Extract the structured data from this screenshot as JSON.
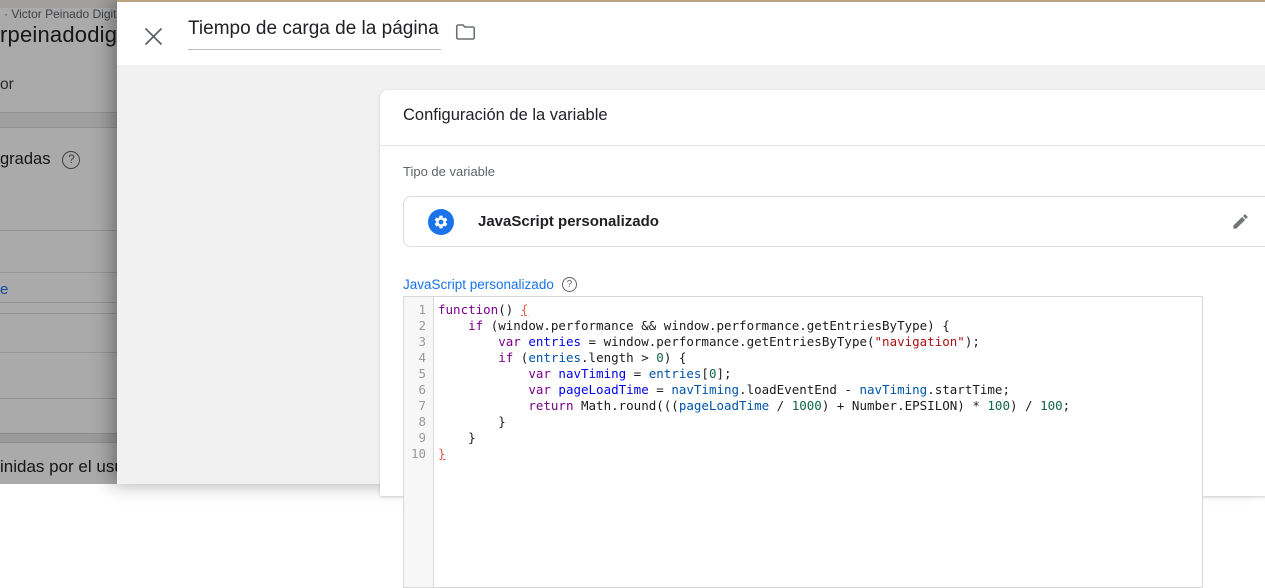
{
  "background_page": {
    "breadcrumb_fragment": "· Victor Peinado Digit",
    "container_name_fragment": "rpeinadodig",
    "menu_fragment": "or",
    "builtin_variables_heading_fragment": "gradas",
    "variable_link_fragment": "e",
    "user_defined_heading_fragment": "inidas por el usu"
  },
  "panel": {
    "title": "Tiempo de carga de la página",
    "card": {
      "title": "Configuración de la variable",
      "type_section_label": "Tipo de variable",
      "type_value": "JavaScript personalizado",
      "code_section_label": "JavaScript personalizado"
    }
  },
  "icons": {
    "help_glyph": "?"
  },
  "colors": {
    "accent_blue": "#1a73e8",
    "type_icon_bg": "#1a73e8",
    "panel_top_accent": "#b7a47e",
    "code_keyword": "#770088",
    "code_def": "#0000ee",
    "code_variable": "#0055aa",
    "code_string": "#aa1111",
    "code_number": "#116644",
    "code_bracket_highlight": "#e0594a"
  },
  "code_editor": {
    "line_count": 10,
    "lines": [
      [
        [
          "function",
          "kw"
        ],
        [
          "() ",
          "pl"
        ],
        [
          "{",
          "bm"
        ]
      ],
      [
        [
          "    ",
          "pl"
        ],
        [
          "if",
          "kw"
        ],
        [
          " (window.performance && window.performance.getEntriesByType) {",
          "pl"
        ]
      ],
      [
        [
          "        ",
          "pl"
        ],
        [
          "var",
          "kw"
        ],
        [
          " ",
          "pl"
        ],
        [
          "entries",
          "df"
        ],
        [
          " = window.performance.getEntriesByType(",
          "pl"
        ],
        [
          "\"navigation\"",
          "st"
        ],
        [
          ");",
          "pl"
        ]
      ],
      [
        [
          "        ",
          "pl"
        ],
        [
          "if",
          "kw"
        ],
        [
          " (",
          "pl"
        ],
        [
          "entries",
          "vr"
        ],
        [
          ".length > ",
          "pl"
        ],
        [
          "0",
          "nm"
        ],
        [
          ") {",
          "pl"
        ]
      ],
      [
        [
          "            ",
          "pl"
        ],
        [
          "var",
          "kw"
        ],
        [
          " ",
          "pl"
        ],
        [
          "navTiming",
          "df"
        ],
        [
          " = ",
          "pl"
        ],
        [
          "entries",
          "vr"
        ],
        [
          "[",
          "pl"
        ],
        [
          "0",
          "nm"
        ],
        [
          "];",
          "pl"
        ]
      ],
      [
        [
          "            ",
          "pl"
        ],
        [
          "var",
          "kw"
        ],
        [
          " ",
          "pl"
        ],
        [
          "pageLoadTime",
          "df"
        ],
        [
          " = ",
          "pl"
        ],
        [
          "navTiming",
          "vr"
        ],
        [
          ".loadEventEnd - ",
          "pl"
        ],
        [
          "navTiming",
          "vr"
        ],
        [
          ".startTime;",
          "pl"
        ]
      ],
      [
        [
          "            ",
          "pl"
        ],
        [
          "return",
          "kw"
        ],
        [
          " Math.round(((",
          "pl"
        ],
        [
          "pageLoadTime",
          "vr"
        ],
        [
          " / ",
          "pl"
        ],
        [
          "1000",
          "nm"
        ],
        [
          ") + Number.EPSILON) * ",
          "pl"
        ],
        [
          "100",
          "nm"
        ],
        [
          ") / ",
          "pl"
        ],
        [
          "100",
          "nm"
        ],
        [
          ";",
          "pl"
        ]
      ],
      [
        [
          "        }",
          "pl"
        ]
      ],
      [
        [
          "    }",
          "pl"
        ]
      ],
      [
        [
          "}",
          "bm"
        ]
      ]
    ]
  }
}
